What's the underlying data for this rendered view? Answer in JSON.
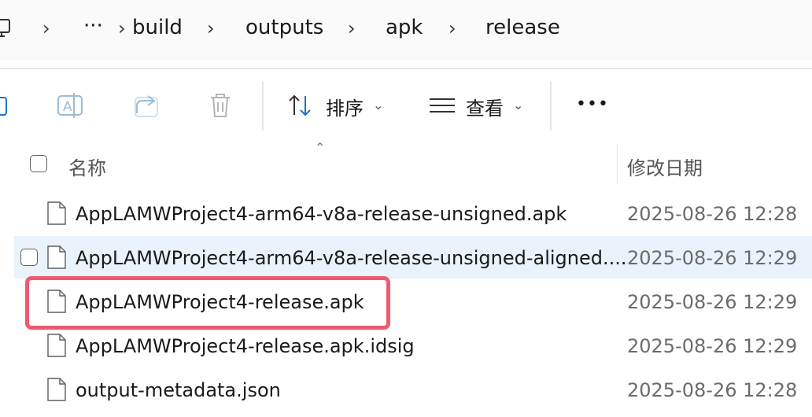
{
  "breadcrumb": {
    "ellipsis": "···",
    "items": [
      "build",
      "outputs",
      "apk",
      "release"
    ]
  },
  "toolbar": {
    "sort_label": "排序",
    "view_label": "查看",
    "more_label": "•••"
  },
  "columns": {
    "name": "名称",
    "date_modified": "修改日期"
  },
  "files": [
    {
      "name": "AppLAMWProject4-arm64-v8a-release-unsigned.apk",
      "date": "2025-08-26 12:28"
    },
    {
      "name": "AppLAMWProject4-arm64-v8a-release-unsigned-aligned....",
      "date": "2025-08-26 12:29"
    },
    {
      "name": "AppLAMWProject4-release.apk",
      "date": "2025-08-26 12:29"
    },
    {
      "name": "AppLAMWProject4-release.apk.idsig",
      "date": "2025-08-26 12:29"
    },
    {
      "name": "output-metadata.json",
      "date": "2025-08-26 12:28"
    }
  ],
  "colors": {
    "hover_row": "#eaf2fb",
    "highlight_box": "#ef5a6f"
  }
}
